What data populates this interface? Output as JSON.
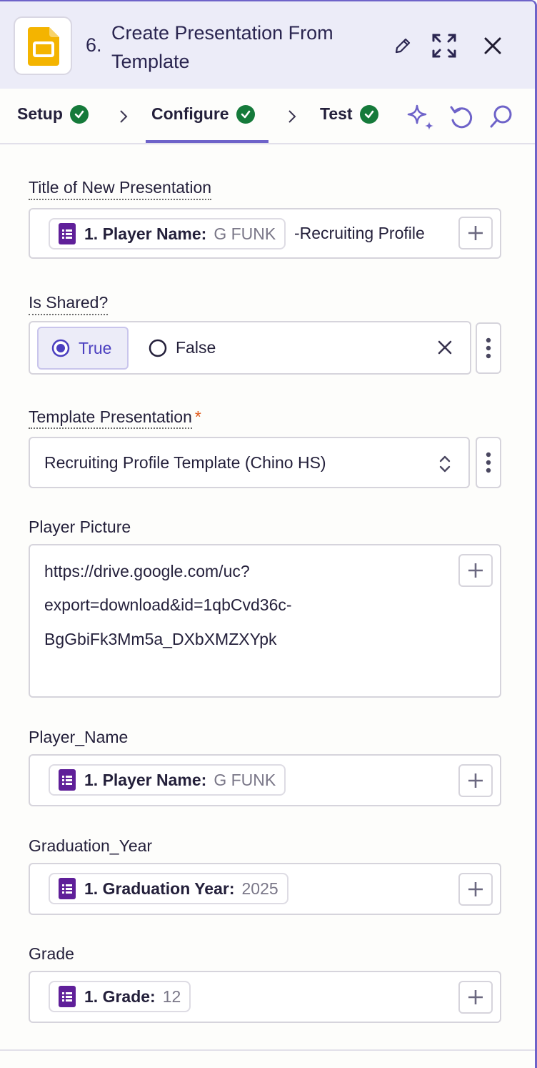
{
  "header": {
    "step_number": "6.",
    "title": "Create Presentation From Template",
    "app_icon": "google-slides-icon",
    "actions": [
      "edit-pencil-icon",
      "expand-icon",
      "close-icon"
    ]
  },
  "tabs": {
    "items": [
      {
        "label": "Setup",
        "status": "complete"
      },
      {
        "label": "Configure",
        "status": "complete",
        "active": true
      },
      {
        "label": "Test",
        "status": "complete"
      }
    ],
    "tools": [
      "ai-sparkle-icon",
      "refresh-icon",
      "search-icon"
    ],
    "accent_color": "#6e63c9",
    "check_color": "#157a3a"
  },
  "fields": {
    "title": {
      "label": "Title of New Presentation",
      "token_key": "1. Player Name:",
      "token_value": "G FUNK",
      "suffix_text": "-Recruiting Profile"
    },
    "is_shared": {
      "label": "Is Shared?",
      "option_true": "True",
      "option_false": "False",
      "selected": "True"
    },
    "template": {
      "label": "Template Presentation",
      "required_mark": "*",
      "value": "Recruiting Profile Template (Chino HS)"
    },
    "player_picture": {
      "label": "Player Picture",
      "lines": [
        "https://drive.google.com/uc?",
        "export=download&id=1qbCvd36c-",
        "BgGbiFk3Mm5a_DXbXMZXYpk"
      ]
    },
    "player_name": {
      "label": "Player_Name",
      "token_key": "1. Player Name:",
      "token_value": "G FUNK"
    },
    "graduation_year": {
      "label": "Graduation_Year",
      "token_key": "1. Graduation Year:",
      "token_value": "2025"
    },
    "grade": {
      "label": "Grade",
      "token_key": "1. Grade:",
      "token_value": "12"
    }
  }
}
